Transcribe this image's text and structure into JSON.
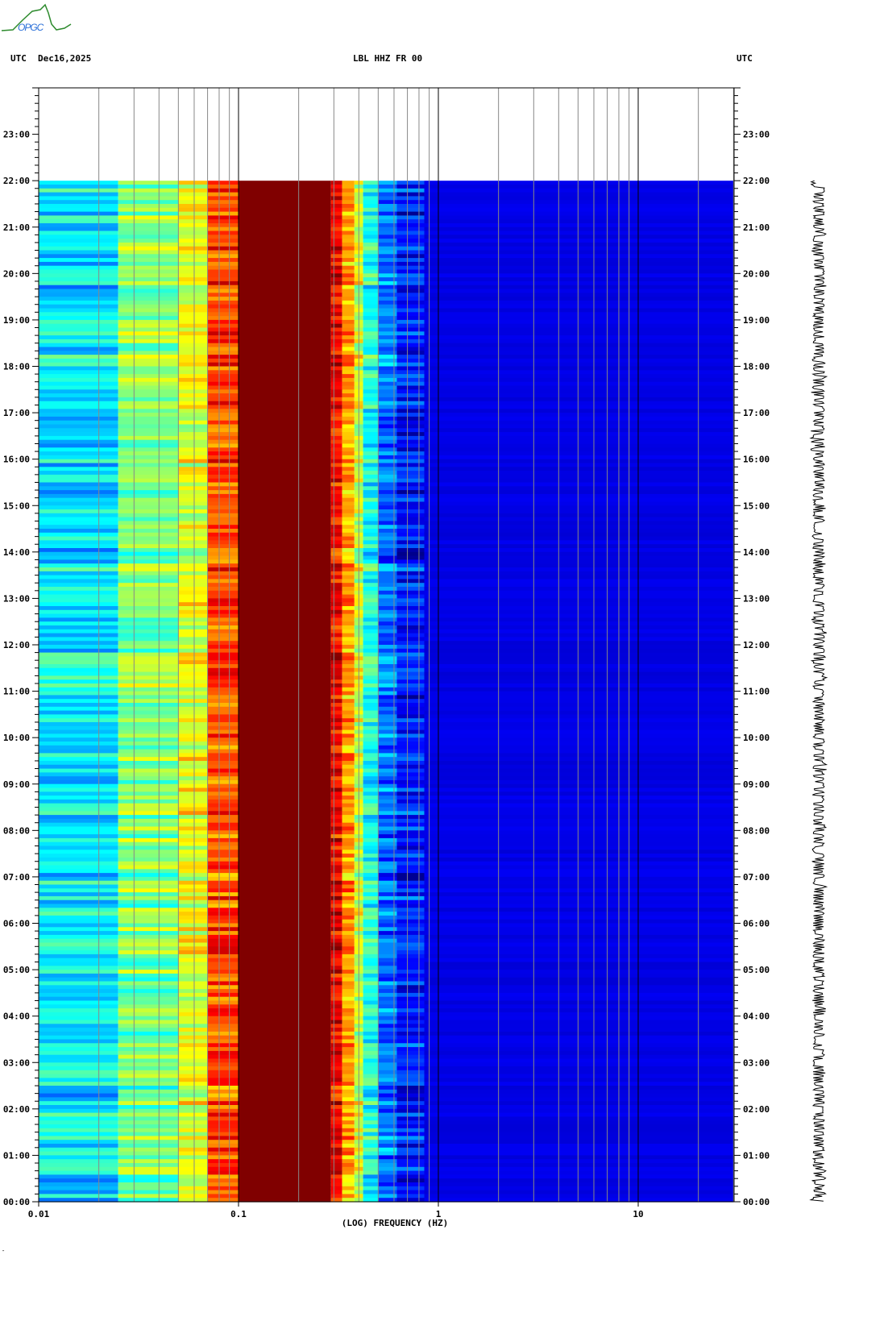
{
  "header": {
    "logo_text": "OPGC",
    "left_tz": "UTC",
    "date": "Dec16,2025",
    "station": "LBL HHZ FR 00",
    "right_tz": "UTC"
  },
  "footer_mark": "″",
  "chart_data": {
    "type": "heatmap",
    "title": "LBL HHZ FR 00",
    "xlabel": "(LOG) FREQUENCY (HZ)",
    "ylabel": "UTC",
    "xscale": "log",
    "xlim": [
      0.01,
      30
    ],
    "ylim_hours": [
      0,
      24
    ],
    "x_tick_labels": [
      {
        "value": 0.01,
        "label": "0.01"
      },
      {
        "value": 0.1,
        "label": "0.1"
      },
      {
        "value": 1,
        "label": "1"
      },
      {
        "value": 10,
        "label": "10"
      }
    ],
    "y_tick_labels": [
      "00:00",
      "01:00",
      "02:00",
      "03:00",
      "04:00",
      "05:00",
      "06:00",
      "07:00",
      "08:00",
      "09:00",
      "10:00",
      "11:00",
      "12:00",
      "13:00",
      "14:00",
      "15:00",
      "16:00",
      "17:00",
      "18:00",
      "19:00",
      "20:00",
      "21:00",
      "22:00",
      "23:00"
    ],
    "minor_tick_minutes": 10,
    "data_end_hour": 22,
    "colormap": "jet",
    "frequency_bands": [
      {
        "f0": 0.01,
        "f1": 0.025,
        "level": 0.36
      },
      {
        "f0": 0.025,
        "f1": 0.05,
        "level": 0.5
      },
      {
        "f0": 0.05,
        "f1": 0.07,
        "level": 0.6
      },
      {
        "f0": 0.07,
        "f1": 0.1,
        "level": 0.8
      },
      {
        "f0": 0.1,
        "f1": 0.29,
        "level": 1.0
      },
      {
        "f0": 0.29,
        "f1": 0.33,
        "level": 0.88
      },
      {
        "f0": 0.33,
        "f1": 0.38,
        "level": 0.72
      },
      {
        "f0": 0.38,
        "f1": 0.42,
        "level": 0.58
      },
      {
        "f0": 0.42,
        "f1": 0.5,
        "level": 0.4
      },
      {
        "f0": 0.5,
        "f1": 0.62,
        "level": 0.24
      },
      {
        "f0": 0.62,
        "f1": 0.85,
        "level": 0.15
      },
      {
        "f0": 0.85,
        "f1": 30,
        "level": 0.1
      }
    ],
    "trace": {
      "label": "seismic trace",
      "start_hour": 0,
      "end_hour": 22
    }
  }
}
